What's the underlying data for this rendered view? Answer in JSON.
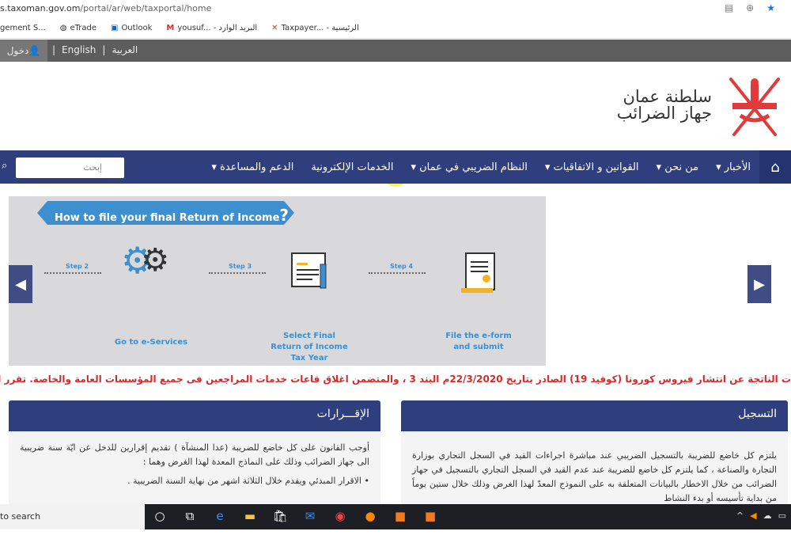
{
  "browser": {
    "url_host": "s.taxoman.gov.om",
    "url_path": "/portal/ar/web/taxportal/home",
    "icons": [
      "translate-icon",
      "zoom-icon",
      "star-icon"
    ],
    "bookmarks": [
      {
        "label": "gement S...",
        "icon": ""
      },
      {
        "label": "eTrade",
        "icon": "globe-icon"
      },
      {
        "label": "Outlook",
        "icon": "outlook-icon"
      },
      {
        "label": "yousuf... - البريد الوارد",
        "icon": "gmail-icon"
      },
      {
        "label": "Taxpayer... - الرئيسية",
        "icon": "emblem-icon"
      }
    ]
  },
  "topbar": {
    "login": "دخول",
    "english": "English",
    "arabic": "العربية",
    "sep": "|"
  },
  "header": {
    "line1": "سلطنة عمان",
    "line2": "جهاز الضرائب",
    "brand_color": "#e03a3a"
  },
  "nav": {
    "items": [
      "الأخبار ▾",
      "من نحن ▾",
      "القوانين و الاتفاقيات ▾",
      "النظام الضريبي في عمان ▾",
      "الخدمات الإلكترونية",
      "الدعم والمساعدة ▾"
    ],
    "search_placeholder": "إبحث",
    "color": "#2f3f7d"
  },
  "slider": {
    "title": "How to file your final Return of Income",
    "q": "?",
    "steps": [
      {
        "label": "Step 2",
        "caption": "Go to e-Services"
      },
      {
        "label": "Step 3",
        "caption": "Select Final Return of Income Tax Year"
      },
      {
        "label": "Step 4",
        "caption": "File the e-form and submit"
      }
    ]
  },
  "ticker": "ت الناتجة عن انتشار فيروس كورونا (كوفيد 19) الصادر بتاريخ 22/3/2020م البند 3 ، والمتضمن اغلاق قاعات خدمات المراجعين فى جميع المؤسسات العامة والخاصة. تقرر اغل",
  "panels": {
    "returns": {
      "title": "الإقـــرارات",
      "body": "أوجب القانون على كل خاضع للضريبة (عدا المنشآة ) تقديم إقرارين للدخل عن ايّة سنة ضريبية الى جهاز الضرائب وذلك على النماذج المعدة لهذا الغرض وهما :",
      "bullet": "الاقرار المبدئي ويقدم خلال الثلاثة اشهر من نهاية السنة الضريبية ."
    },
    "registration": {
      "title": "التسجيل",
      "body": "يلتزم كل خاضع للضريبة بالتسجيل الضريبي عند مباشرة اجراءات القيد في السجل التجاري بوزارة التجارة والصناعة ، كما يلتزم كل خاضع للضريبة عند عدم القيد في السجل التجاري بالتسجيل في جهاز الضرائب من خلال الاخطار بالبيانات المتعلقة به على النموذج المعدّ لهذا الغرض وذلك خلال ستين يوماً من بداية تأسيسه أو بدء النشاط"
    }
  },
  "taskbar": {
    "search": "to search"
  }
}
